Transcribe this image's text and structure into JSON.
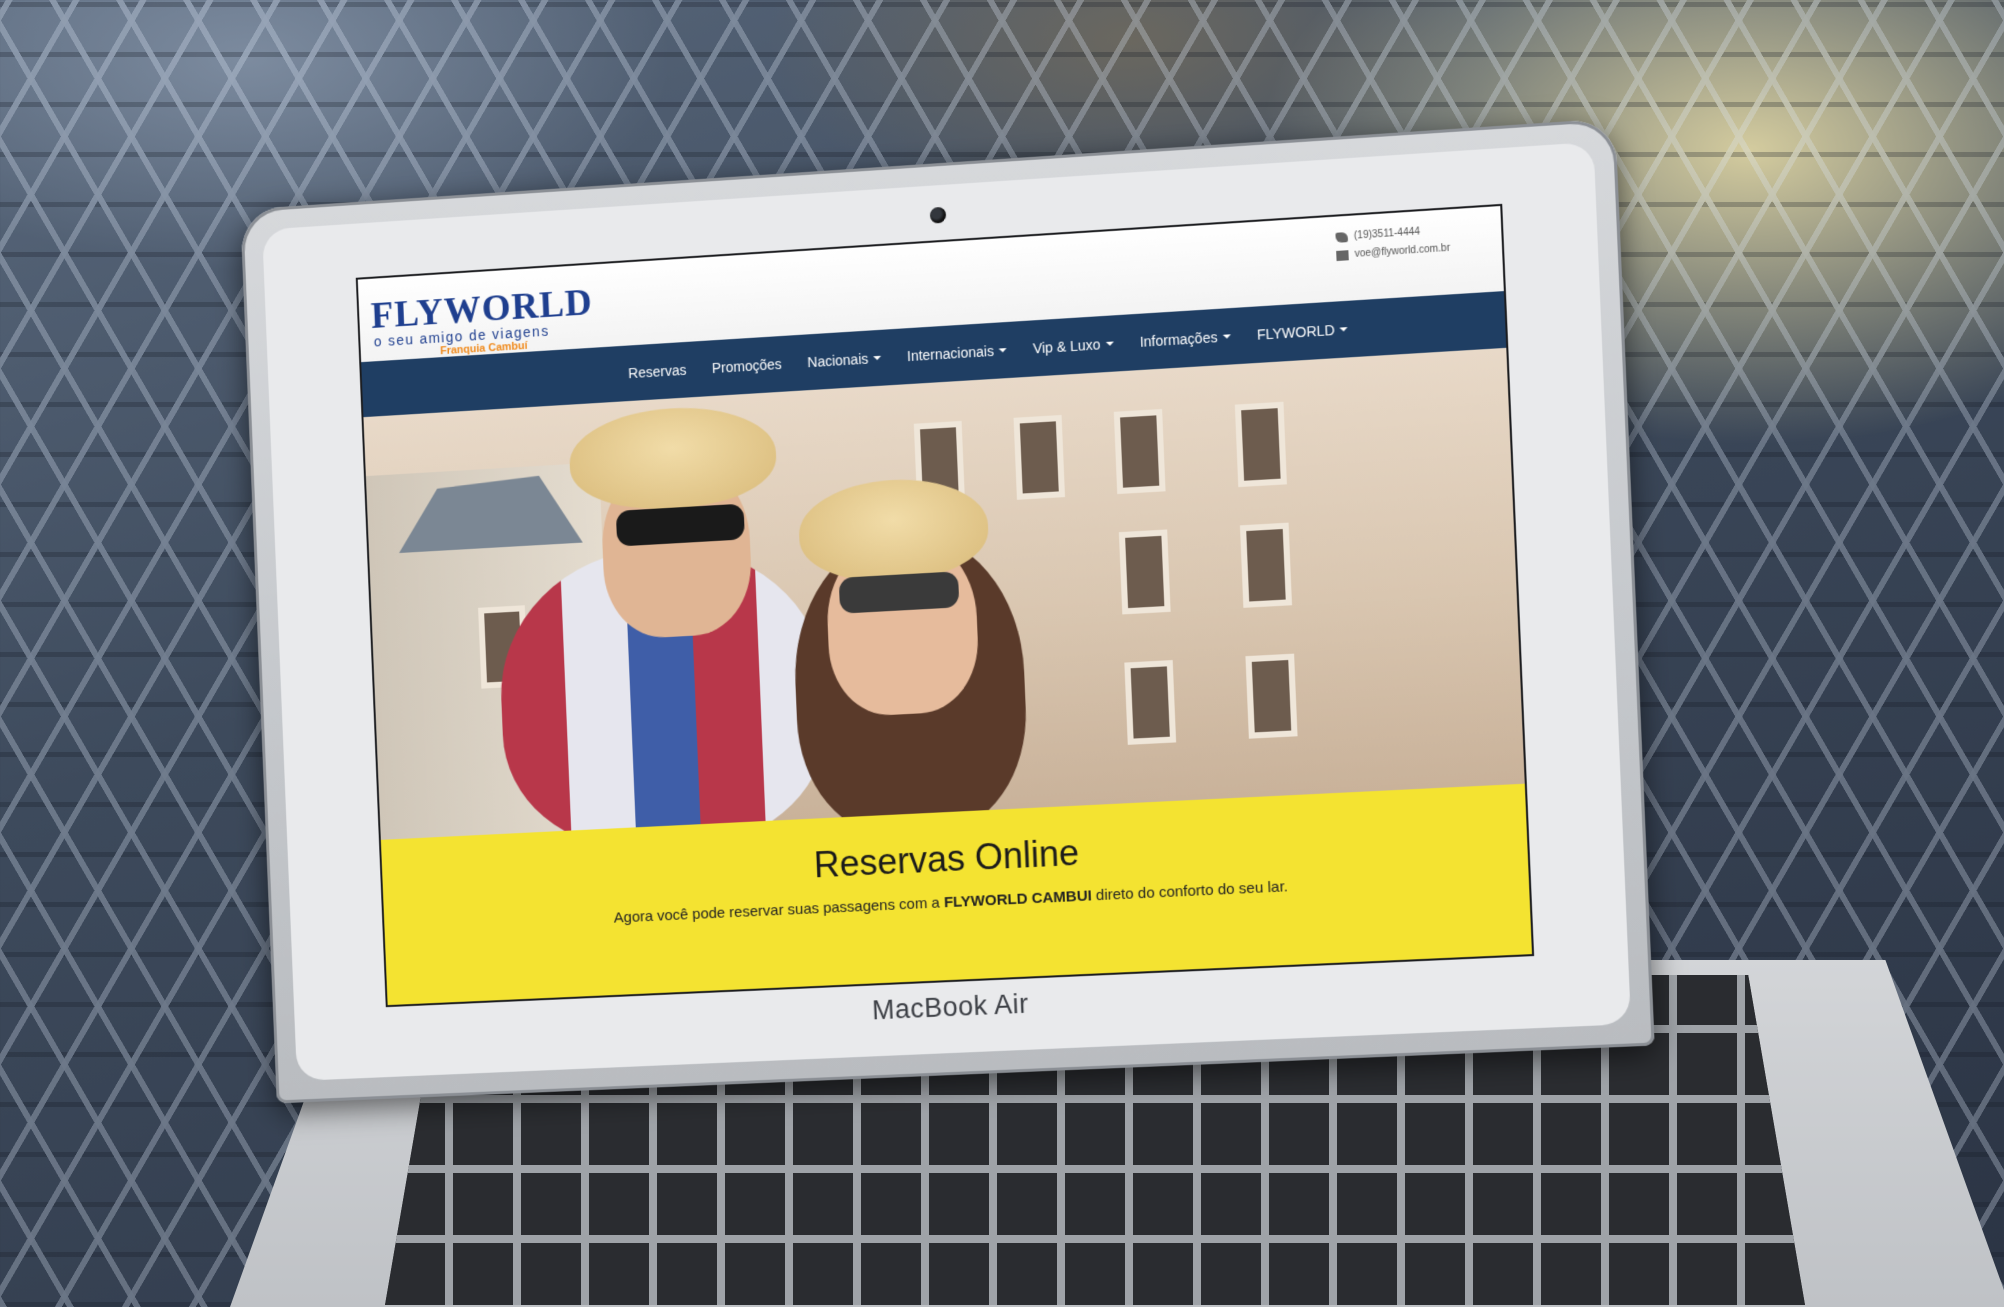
{
  "device": {
    "brand_label": "MacBook Air"
  },
  "site": {
    "logo": {
      "wordmark": "FLYWORLD",
      "tagline": "o seu amigo de viagens",
      "franchise": "Franquia Cambuí"
    },
    "contact": {
      "phone": "(19)3511-4444",
      "email": "voe@flyworld.com.br"
    },
    "nav": {
      "items": [
        {
          "label": "Reservas",
          "dropdown": false
        },
        {
          "label": "Promoções",
          "dropdown": false
        },
        {
          "label": "Nacionais",
          "dropdown": true
        },
        {
          "label": "Internacionais",
          "dropdown": true
        },
        {
          "label": "Vip & Luxo",
          "dropdown": true
        },
        {
          "label": "Informações",
          "dropdown": true
        },
        {
          "label": "FLYWORLD",
          "dropdown": true
        }
      ]
    },
    "banner": {
      "title": "Reservas Online",
      "text_before": "Agora você pode reservar suas passagens com a",
      "text_bold": "FLYWORLD CAMBUI",
      "text_after": "direto do conforto do seu lar."
    },
    "colors": {
      "navbar": "#1f3e63",
      "banner": "#f4e331",
      "logo_blue": "#1f3f8f",
      "logo_orange": "#f08a1c"
    }
  }
}
